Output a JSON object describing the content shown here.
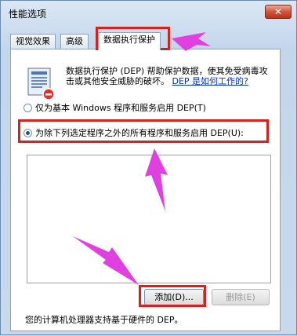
{
  "window": {
    "title": "性能选项",
    "close_label": "✕"
  },
  "tabs": [
    {
      "label": "视觉效果",
      "active": false
    },
    {
      "label": "高级",
      "active": false
    },
    {
      "label": "数据执行保护",
      "active": true
    }
  ],
  "dep": {
    "description": "数据执行保护 (DEP) 帮助保护数据，使其免受病毒攻击或其他安全威胁的破坏。",
    "help_link": "DEP 是如何工作的?",
    "options": [
      {
        "label": "仅为基本 Windows 程序和服务启用 DEP(T)",
        "checked": false
      },
      {
        "label": "为除下列选定程序之外的所有程序和服务启用 DEP(U):",
        "checked": true
      }
    ],
    "add_button": "添加(D)...",
    "remove_button": "删除(E)",
    "hardware_support": "您的计算机处理器支持基于硬件的 DEP。"
  },
  "annotations": {
    "highlight_color": "#d6221b",
    "arrow_color": "#e040e0"
  }
}
